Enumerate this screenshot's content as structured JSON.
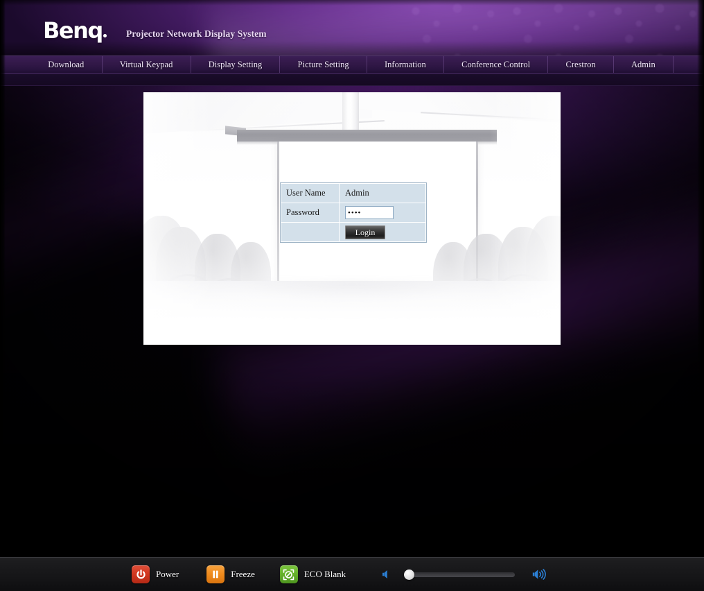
{
  "header": {
    "logo_text": "Benq",
    "title": "Projector Network Display System"
  },
  "nav": {
    "items": [
      {
        "label": "Download"
      },
      {
        "label": "Virtual Keypad"
      },
      {
        "label": "Display Setting"
      },
      {
        "label": "Picture Setting"
      },
      {
        "label": "Information"
      },
      {
        "label": "Conference Control"
      },
      {
        "label": "Crestron"
      },
      {
        "label": "Admin"
      }
    ]
  },
  "login": {
    "username_label": "User Name",
    "username_value": "Admin",
    "password_label": "Password",
    "password_value": "····",
    "password_placeholder": "",
    "login_button": "Login"
  },
  "toolbar": {
    "power_label": "Power",
    "power_icon": "power-icon",
    "freeze_label": "Freeze",
    "freeze_icon": "pause-icon",
    "eco_blank_label": "ECO Blank",
    "eco_blank_icon": "eco-blank-icon",
    "volume_down_icon": "volume-down-icon",
    "volume_up_icon": "volume-up-icon",
    "volume_value": 0
  },
  "colors": {
    "header_purple": "#5c2583",
    "nav_purple": "#331949",
    "power_red": "#d1361f",
    "freeze_orange": "#ef8a1c",
    "eco_green": "#64b02a",
    "volume_blue": "#2b7fd4",
    "form_blue": "#d3e0ea"
  }
}
